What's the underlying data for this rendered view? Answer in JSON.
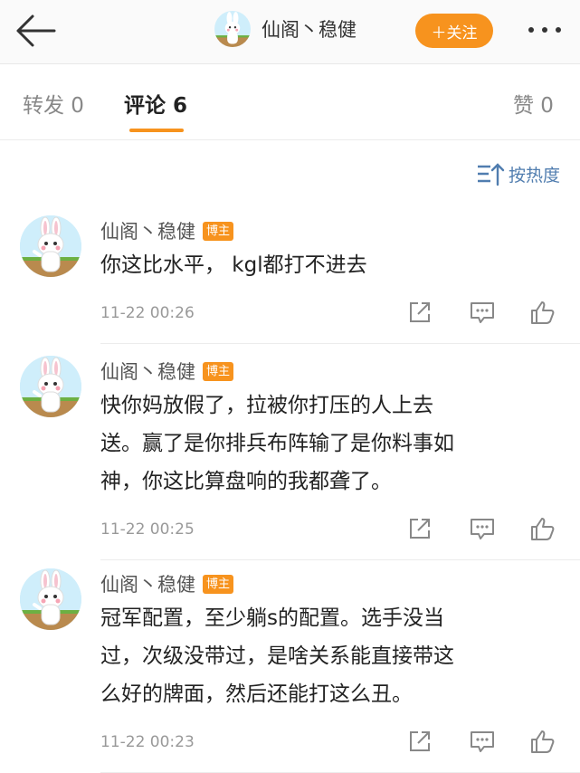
{
  "header": {
    "user_name": "仙阁丶稳健",
    "follow_label": "＋关注"
  },
  "tabs": {
    "repost": "转发 0",
    "comment": "评论 6",
    "like": "赞 0"
  },
  "sort_label": "按热度",
  "comments": [
    {
      "name": "仙阁丶稳健",
      "badge": "博主",
      "lines": [
        "你这比水平， kgl都打不进去"
      ],
      "time": "11-22 00:26"
    },
    {
      "name": "仙阁丶稳健",
      "badge": "博主",
      "lines": [
        "快你妈放假了，拉被你打压的人上去",
        "送。赢了是你排兵布阵输了是你料事如",
        "神，你这比算盘响的我都聋了。"
      ],
      "time": "11-22 00:25"
    },
    {
      "name": "仙阁丶稳健",
      "badge": "博主",
      "lines": [
        "冠军配置，至少躺s的配置。选手没当",
        "过，次级没带过，是啥关系能直接带这",
        "么好的牌面，然后还能打这么丑。"
      ],
      "time": "11-22 00:23"
    }
  ],
  "colors": {
    "accent": "#f7931e",
    "link": "#507daf",
    "text": "#222222",
    "muted": "#999999"
  },
  "icons": [
    "back-arrow-icon",
    "more-icon",
    "sort-icon",
    "share-icon",
    "reply-icon",
    "like-icon"
  ]
}
